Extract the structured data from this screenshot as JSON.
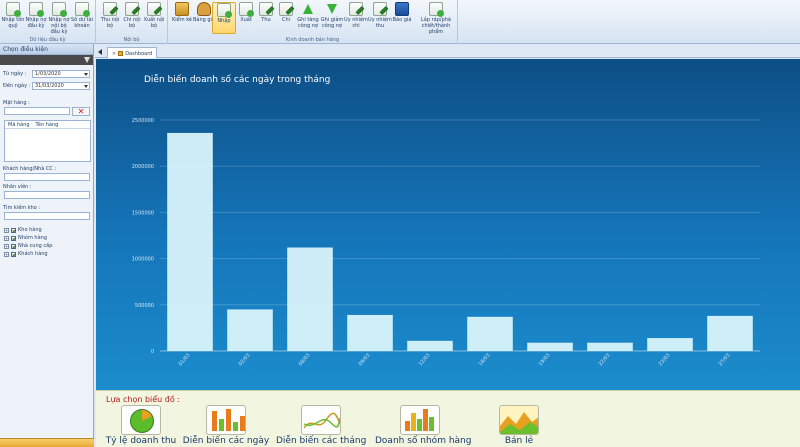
{
  "ribbon": {
    "groups": [
      {
        "title": "Dữ liệu đầu kỳ",
        "buttons": [
          {
            "label": "Nhập tồn quỹ"
          },
          {
            "label": "Nhập nợ đầu kỳ"
          },
          {
            "label": "Nhập nợ nội bộ đầu kỳ"
          },
          {
            "label": "Số dư tài khoản"
          }
        ]
      },
      {
        "title": "Nội bộ",
        "buttons": [
          {
            "label": "Thu nội bộ"
          },
          {
            "label": "Chi nội bộ"
          },
          {
            "label": "Xuất nội bộ"
          }
        ]
      },
      {
        "title": "Kinh doanh bán hàng",
        "buttons": [
          {
            "label": "Kiểm kê"
          },
          {
            "label": "Bảng giá"
          },
          {
            "label": "Nhập"
          },
          {
            "label": "Xuất"
          },
          {
            "label": "Thu"
          },
          {
            "label": "Chi"
          },
          {
            "label": "Ghi tăng công nợ"
          },
          {
            "label": "Ghi giảm công nợ"
          },
          {
            "label": "Uy nhiệm chi"
          },
          {
            "label": "Uy nhiệm thu"
          },
          {
            "label": "Báo giá"
          },
          {
            "label": "Lắp ráp/phá chiết/thành phẩm"
          }
        ]
      }
    ]
  },
  "left_panel": {
    "title": "Chọn điều kiện",
    "from_date_label": "Từ ngày :",
    "from_date_value": "1/03/2020",
    "to_date_label": "Đến ngày :",
    "to_date_value": "31/03/2020",
    "item_label": "Mặt hàng :",
    "grid_headers": [
      "Mã hàng",
      "Tên hàng"
    ],
    "customer_label": "Khách hàng/Nhà CC :",
    "staff_label": "Nhân viên :",
    "search_label": "Tìm kiếm kho :",
    "tree_items": [
      "Kho hàng",
      "Nhóm hàng",
      "Nhà cung cấp",
      "Khách hàng"
    ]
  },
  "tabs": {
    "active": "Dashboard"
  },
  "chart_data": {
    "type": "bar",
    "title": "Diễn biến doanh số các ngày trong tháng",
    "categories": [
      "01/03",
      "02/03",
      "08/03",
      "09/03",
      "12/03",
      "18/03",
      "19/03",
      "22/03",
      "23/03",
      "27/03"
    ],
    "values": [
      2360000,
      450000,
      1120000,
      390000,
      110000,
      370000,
      90000,
      90000,
      140000,
      380000
    ],
    "ylim": [
      0,
      2500000
    ],
    "yticks": [
      0,
      500000,
      1000000,
      1500000,
      2000000,
      2500000
    ],
    "ytick_labels": [
      "0",
      "500000",
      "1000000",
      "1500000",
      "2000000",
      "2500000"
    ],
    "grid": true,
    "bar_color": "#d8f3fb"
  },
  "selector": {
    "title": "Lựa chọn biểu đồ :",
    "options": [
      {
        "label": "Tỷ lệ doanh thu"
      },
      {
        "label": "Diễn biến các ngày"
      },
      {
        "label": "Diễn biến các tháng"
      },
      {
        "label": "Doanh số nhóm hàng"
      },
      {
        "label": "Bán lẻ"
      }
    ]
  }
}
